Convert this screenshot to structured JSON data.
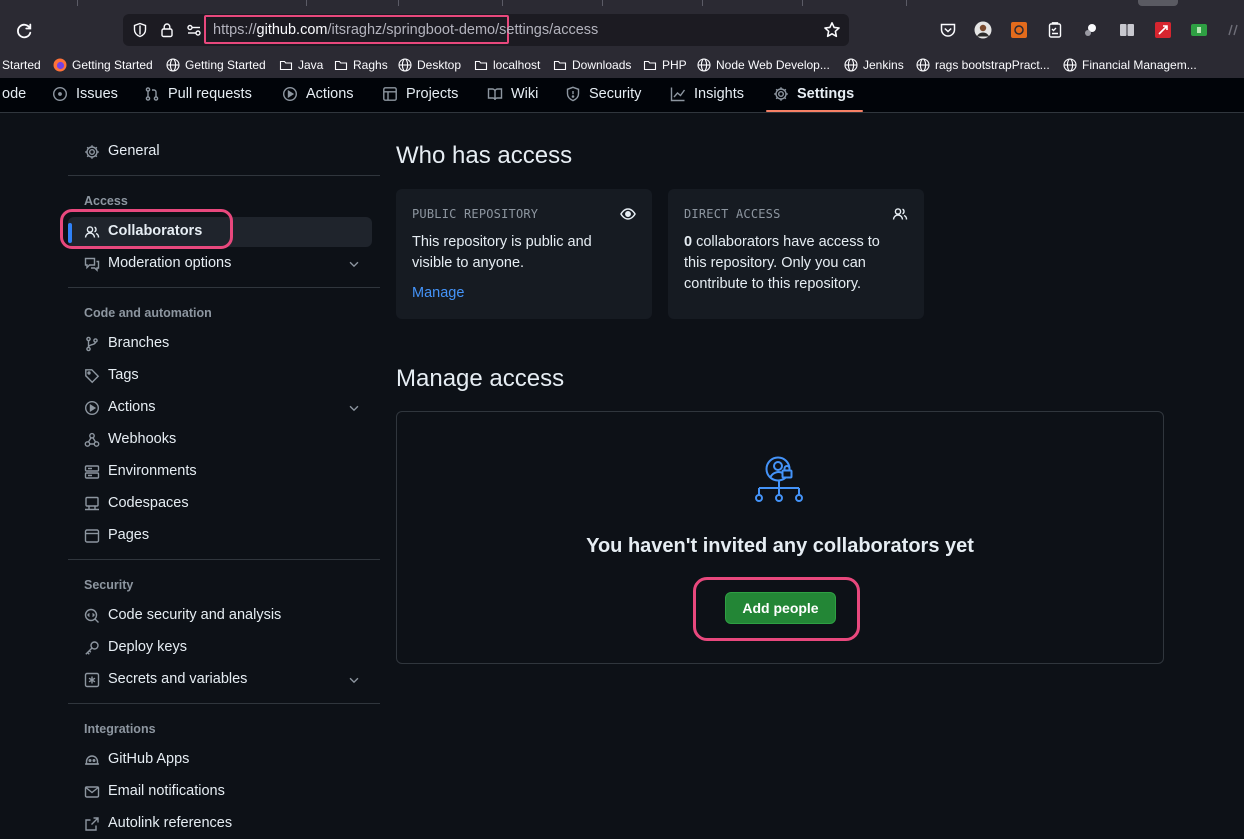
{
  "browser": {
    "url_prefix": "https://",
    "url_host": "github.com",
    "url_rest": "/itsraghz/springboot-demo/settings/access",
    "bookmarks": [
      {
        "label": "Started",
        "icon": "none"
      },
      {
        "label": "Getting Started",
        "icon": "firefox-icon"
      },
      {
        "label": "Getting Started",
        "icon": "globe-icon"
      },
      {
        "label": "Java",
        "icon": "folder-icon"
      },
      {
        "label": "Raghs",
        "icon": "folder-icon"
      },
      {
        "label": "Desktop",
        "icon": "globe-icon"
      },
      {
        "label": "localhost",
        "icon": "folder-icon"
      },
      {
        "label": "Downloads",
        "icon": "folder-icon"
      },
      {
        "label": "PHP",
        "icon": "folder-icon"
      },
      {
        "label": "Node Web Develop...",
        "icon": "globe-icon"
      },
      {
        "label": "Jenkins",
        "icon": "globe-icon"
      },
      {
        "label": "rags bootstrapPract...",
        "icon": "globe-icon"
      },
      {
        "label": "Financial Managem...",
        "icon": "globe-icon"
      }
    ]
  },
  "repo_nav": {
    "items": [
      {
        "label": "ode",
        "icon": "none"
      },
      {
        "label": "Issues",
        "icon": "issue-icon"
      },
      {
        "label": "Pull requests",
        "icon": "pull-request-icon"
      },
      {
        "label": "Actions",
        "icon": "play-icon"
      },
      {
        "label": "Projects",
        "icon": "table-icon"
      },
      {
        "label": "Wiki",
        "icon": "book-icon"
      },
      {
        "label": "Security",
        "icon": "shield-icon"
      },
      {
        "label": "Insights",
        "icon": "graph-icon"
      },
      {
        "label": "Settings",
        "icon": "gear-icon",
        "active": true
      }
    ]
  },
  "sidebar": {
    "general": "General",
    "access_heading": "Access",
    "collaborators": "Collaborators",
    "moderation": "Moderation options",
    "code_heading": "Code and automation",
    "branches": "Branches",
    "tags": "Tags",
    "actions": "Actions",
    "webhooks": "Webhooks",
    "environments": "Environments",
    "codespaces": "Codespaces",
    "pages": "Pages",
    "security_heading": "Security",
    "code_security": "Code security and analysis",
    "deploy_keys": "Deploy keys",
    "secrets": "Secrets and variables",
    "integrations_heading": "Integrations",
    "github_apps": "GitHub Apps",
    "email_notifications": "Email notifications",
    "autolink": "Autolink references"
  },
  "main": {
    "who_has_access": "Who has access",
    "public_card": {
      "title": "PUBLIC REPOSITORY",
      "body": "This repository is public and visible to anyone.",
      "link": "Manage"
    },
    "direct_card": {
      "title": "DIRECT ACCESS",
      "count": "0",
      "body": " collaborators have access to this repository. Only you can contribute to this repository."
    },
    "manage_access": "Manage access",
    "empty_message": "You haven't invited any collaborators yet",
    "add_people": "Add people"
  },
  "colors": {
    "background": "#0d1117",
    "accent_blue": "#2f81f7",
    "button_green": "#238636",
    "highlight_pink": "#e8487d",
    "active_underline": "#f78166"
  }
}
